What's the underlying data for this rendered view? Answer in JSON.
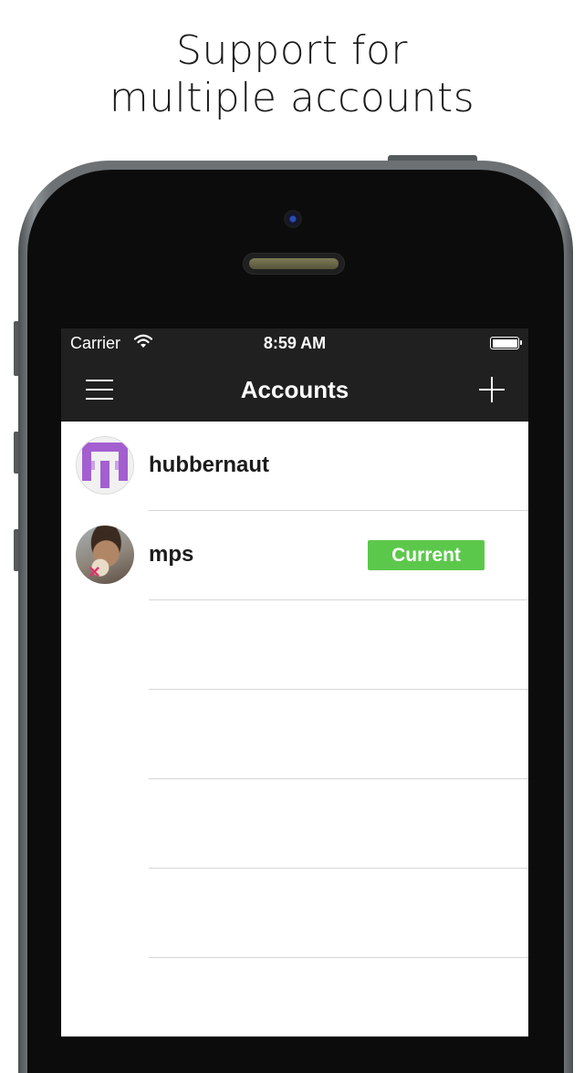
{
  "promo": {
    "line1": "Support for",
    "line2": "multiple accounts"
  },
  "status_bar": {
    "carrier": "Carrier",
    "time": "8:59 AM",
    "wifi_icon": "wifi-icon",
    "battery_icon": "battery-icon",
    "battery_level": 1.0
  },
  "nav": {
    "title": "Accounts",
    "menu_icon": "hamburger-menu-icon",
    "add_icon": "plus-icon"
  },
  "accounts": [
    {
      "username": "hubbernaut",
      "avatar": "identicon-avatar",
      "current": false
    },
    {
      "username": "mps",
      "avatar": "photo-avatar",
      "current": true
    }
  ],
  "current_badge_label": "Current",
  "colors": {
    "bar_background": "#202020",
    "badge_green": "#5cc84b",
    "identicon_purple": "#a35fd0",
    "separator": "#d6d6d6"
  }
}
